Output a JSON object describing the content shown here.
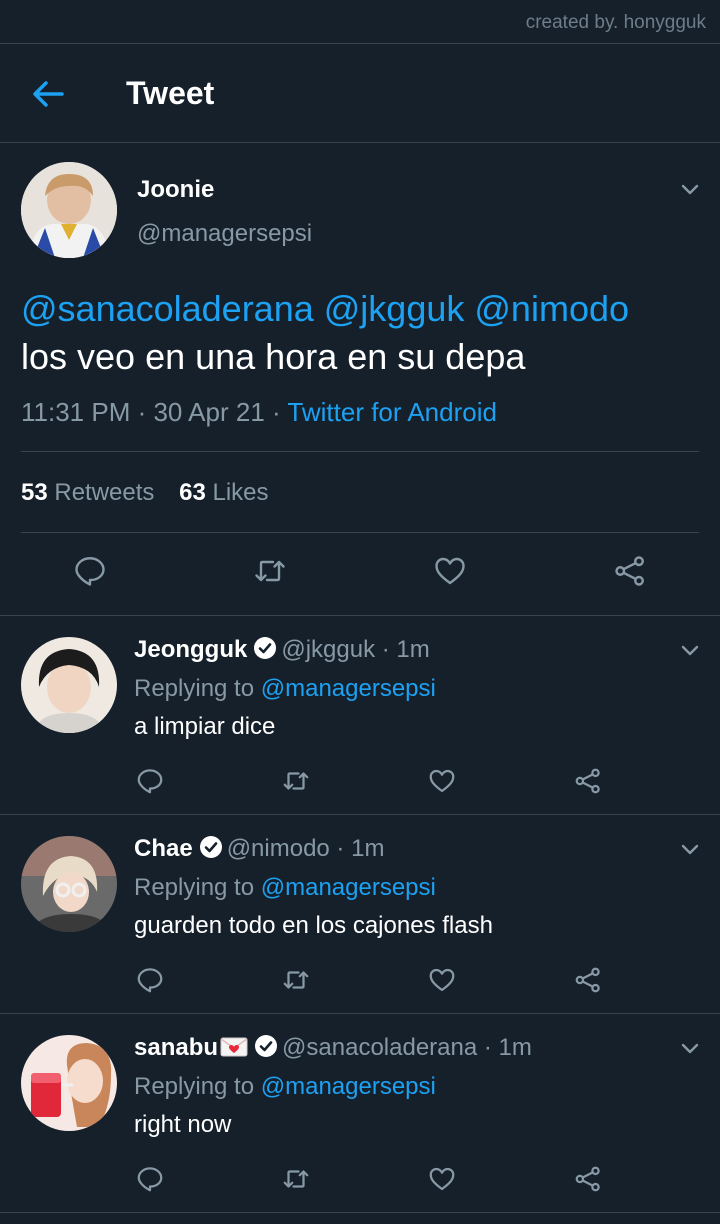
{
  "credit": "created by. honygguk",
  "header": {
    "title": "Tweet"
  },
  "tweet": {
    "name": "Joonie",
    "handle": "@managersepsi",
    "mentions": [
      "@sanacoladerana",
      "@jkgguk",
      "@nimodo"
    ],
    "text": "los veo en una hora en su depa",
    "time": "11:31 PM · 30 Apr 21 · ",
    "source": "Twitter for Android",
    "retweets": "53",
    "retweets_label": "Retweets",
    "likes": "63",
    "likes_label": "Likes"
  },
  "replies": [
    {
      "name": "Jeongguk",
      "handle": "@jkgguk · 1m",
      "replying_label": "Replying to ",
      "replying_to": "@managersepsi",
      "text": "a limpiar dice"
    },
    {
      "name": "Chae",
      "handle": "@nimodo · 1m",
      "replying_label": "Replying to ",
      "replying_to": "@managersepsi",
      "text": "guarden todo en los cajones flash"
    },
    {
      "name": "sanabu",
      "handle": "@sanacoladerana · 1m",
      "replying_label": "Replying to ",
      "replying_to": "@managersepsi",
      "text": "right now"
    }
  ],
  "colors": {
    "background": "#15202b",
    "accent": "#1da1f2",
    "secondary_text": "#8899a6",
    "divider": "#38444d"
  },
  "icons": [
    "back-arrow-icon",
    "chevron-down-icon",
    "reply-icon",
    "retweet-icon",
    "like-icon",
    "share-icon",
    "verified-icon",
    "love-letter-icon"
  ]
}
